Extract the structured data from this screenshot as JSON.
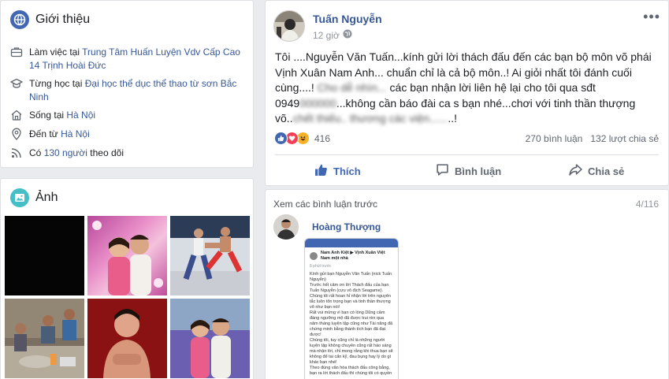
{
  "intro": {
    "title": "Giới thiệu",
    "work_prefix": "Làm việc tại ",
    "work_place": "Trung Tâm Huấn Luyện Vdv Cấp Cao 14 Trịnh Hoài Đức",
    "study_prefix": "Từng học tại ",
    "study_place": "Đại học thể dục thể thao từ sơn Bắc Ninh",
    "lives_prefix": "Sống tại ",
    "lives_place": "Hà Nội",
    "from_prefix": "Đến từ ",
    "from_place": "Hà Nội",
    "followers_prefix": "Có ",
    "followers_link": "130 người",
    "followers_suffix": " theo dõi"
  },
  "photos": {
    "title": "Ảnh"
  },
  "post": {
    "author": "Tuấn Nguyễn",
    "time": "12 giờ",
    "text_a": "Tôi ....Nguyễn Văn Tuấn...kính gửi lời thách đấu đến các bạn bộ môn võ phái Vịnh Xuân Nam Anh... chuẩn chỉ là cả bộ môn..! Ai giỏi nhất tôi đánh cuối cùng....! ",
    "text_blur1": "Cho dễ nhìn...",
    "text_b": " các bạn nhận lời liên hệ lại cho tôi qua sđt 0949",
    "text_blur2": "000000",
    "text_c": "...không cần báo đài ca s bạn nhé...chơi với tinh thần thượng võ..",
    "text_blur3": "chết thiếu.. thương các viện......",
    "text_d": "..!",
    "reaction_count": "416",
    "comments_stat": "270 bình luận",
    "shares_stat": "132 lượt chia sẻ",
    "like_label": "Thích",
    "comment_label": "Bình luận",
    "share_label": "Chia sẻ"
  },
  "comments": {
    "prev_label": "Xem các bình luận trước",
    "count": "4/116",
    "commenter": "Hoàng Thượng",
    "shot_title": "Nam Anh Kiệt ▶ Vịnh Xuân Việt Nam một nhà",
    "shot_time": "8 phút trước",
    "shot_body": "Kính gửi bạn Nguyễn Văn Tuấn (nick Tuấn Nguyễn)\nTrước hết cảm ơn lời Thách đấu của bạn Tuấn Nguyễn (cựu vô địch Seagame). Chúng tôi rất hoan hỉ nhận lời trên nguyên tắc luôn tôn trọng bạn và tinh thần thượng võ như bạn nói!\nRất vui mừng vì bạn có lòng Dũng cảm đáng ngưỡng mộ đã được trui rèn qua năm tháng luyện tập cũng như Tài năng đã chứng minh bằng thành tích bạn đã đạt được!\nChúng tôi, tuy cũng chỉ là những người luyện tập không chuyên cũng rất háo sáng mà nhận lời, chỉ mong rằng khi thua bạn sẽ không để tai cẩn kỹ, đau bụng hay lý do gì khác bạn nhé!\nTheo đúng văn hóa thách đấu công bằng, bạn ra lời thách đấu thì chúng tôi có quyền"
  },
  "colors": {
    "accent": "#4267b2",
    "link": "#365899",
    "background": "#e9ebee"
  }
}
